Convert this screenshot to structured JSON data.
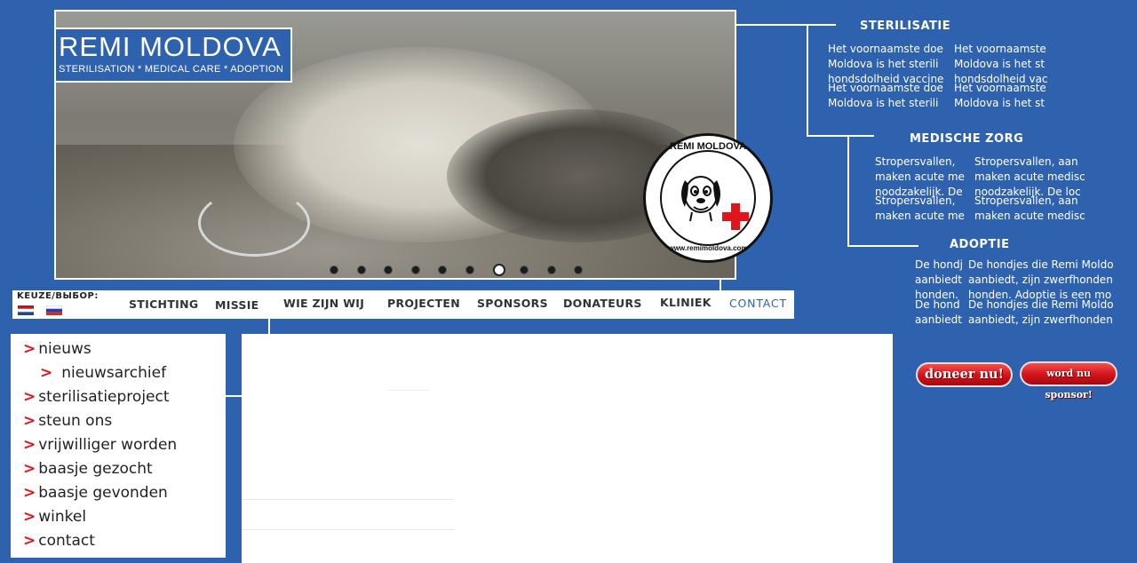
{
  "header": {
    "title": "REMI MOLDOVA",
    "subtitle": "STERILISATION * MEDICAL CARE * ADOPTION"
  },
  "logo": {
    "top_text": "REMI MOLDOVA",
    "bottom_text": "www.remimoldova.com"
  },
  "slider": {
    "total": 10,
    "active_index": 6
  },
  "panels": [
    {
      "heading": "STERILISATIE",
      "lines": [
        "Het voornaamste doe",
        "Moldova is het sterili",
        "hondsdolheid vaccine",
        "Het voornaamste doe",
        "Moldova is het sterili"
      ],
      "lines2": [
        "Het voornaamste",
        "Moldova is het st",
        "hondsdolheid vac",
        "Het voornaamste",
        "Moldova is het st"
      ]
    },
    {
      "heading": "MEDISCHE ZORG",
      "lines": [
        "Stropersvallen,",
        "maken acute me",
        "noodzakelijk. De",
        "Stropersvallen,",
        "maken acute me"
      ],
      "lines2": [
        "Stropersvallen, aan",
        "maken acute medisc",
        "noodzakelijk. De loc",
        "Stropersvallen, aan",
        "maken acute medisc"
      ]
    },
    {
      "heading": "ADOPTIE",
      "lines": [
        "De hondj",
        "aanbiedt",
        "honden.",
        "De hond",
        "aanbiedt"
      ],
      "lines2": [
        "De hondjes die Remi Moldo",
        "aanbiedt, zijn zwerfhonden",
        "honden. Adoptie is een mo",
        "De hondjes die Remi Moldo",
        "aanbiedt, zijn zwerfhonden"
      ]
    }
  ],
  "nav": {
    "language_label": "KEUZE/ВЫБОР:",
    "items": [
      "STICHTING",
      "MISSIE",
      "WIE ZIJN WIJ",
      "PROJECTEN",
      "SPONSORS",
      "DONATEURS",
      "KLINIEK",
      "CONTACT"
    ]
  },
  "menu": {
    "items": [
      {
        "arrow": ">",
        "label": "nieuws"
      },
      {
        "arrow": ">",
        "label": "nieuwsarchief"
      },
      {
        "arrow": ">",
        "label": "sterilisatieproject"
      },
      {
        "arrow": ">",
        "label": "steun ons"
      },
      {
        "arrow": ">",
        "label": "vrijwilliger worden"
      },
      {
        "arrow": ">",
        "label": "baasje gezocht"
      },
      {
        "arrow": ">",
        "label": "baasje gevonden"
      },
      {
        "arrow": ">",
        "label": "winkel"
      },
      {
        "arrow": ">",
        "label": "contact"
      }
    ]
  },
  "buttons": {
    "donate": "doneer nu!",
    "sponsor": "word nu sponsor!"
  },
  "colors": {
    "background": "#2f62ae",
    "accent_red": "#e0141b",
    "nav_contact": "#2f62ae"
  }
}
